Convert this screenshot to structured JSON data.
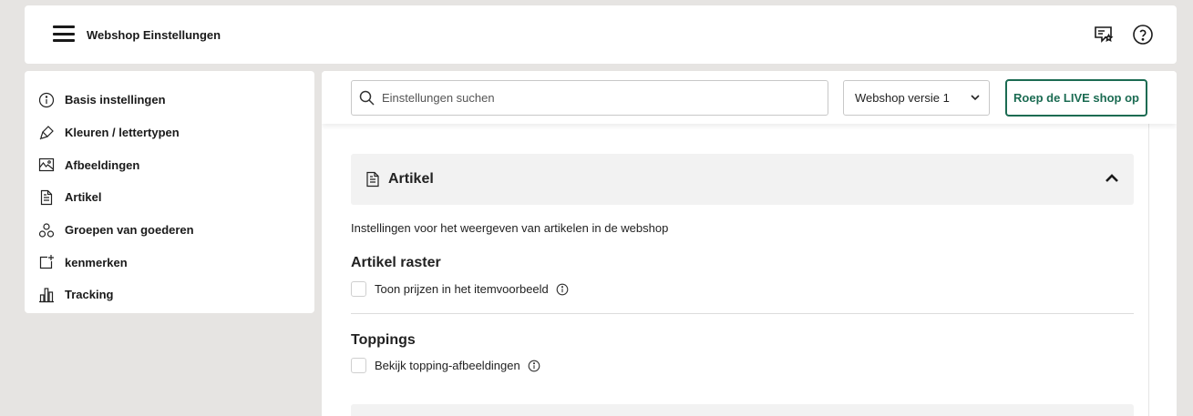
{
  "header": {
    "title": "Webshop Einstellungen",
    "icons": [
      "menu-icon",
      "reviews-icon",
      "help-icon"
    ]
  },
  "sidebar": {
    "items": [
      {
        "label": "Basis instellingen",
        "icon": "info-circle-icon"
      },
      {
        "label": "Kleuren / lettertypen",
        "icon": "paint-brush-icon"
      },
      {
        "label": "Afbeeldingen",
        "icon": "image-icon"
      },
      {
        "label": "Artikel",
        "icon": "document-icon"
      },
      {
        "label": "Groepen van goederen",
        "icon": "groups-icon"
      },
      {
        "label": "kenmerken",
        "icon": "add-feature-icon"
      },
      {
        "label": "Tracking",
        "icon": "bar-chart-icon"
      }
    ]
  },
  "toolbar": {
    "search_placeholder": "Einstellungen suchen",
    "search_value": "",
    "version_selected": "Webshop versie 1",
    "live_button_label": "Roep de LIVE shop op"
  },
  "section": {
    "title": "Artikel",
    "expanded": true,
    "description": "Instellingen voor het weergeven van artikelen in de webshop",
    "groups": [
      {
        "title": "Artikel raster",
        "option_label": "Toon prijzen in het itemvoorbeeld",
        "checked": false
      },
      {
        "title": "Toppings",
        "option_label": "Bekijk topping-afbeeldingen",
        "checked": false
      }
    ]
  },
  "colors": {
    "accent": "#1b6b52",
    "background": "#e6e4e2",
    "panel": "#ffffff",
    "section_header": "#f2f2f2"
  }
}
